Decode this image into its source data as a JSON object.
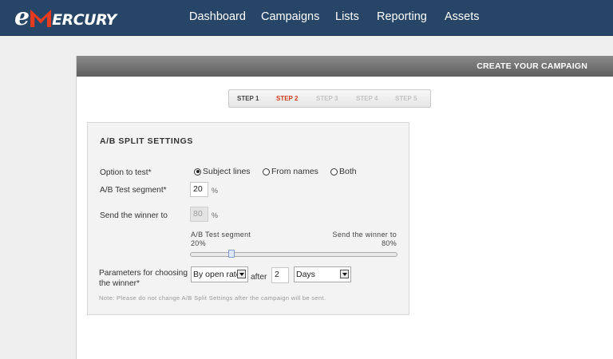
{
  "brand": {
    "logo_e": "e",
    "logo_rest": "ERCURY"
  },
  "nav": [
    {
      "label": "Dashboard"
    },
    {
      "label": "Campaigns"
    },
    {
      "label": "Lists"
    },
    {
      "label": "Reporting"
    },
    {
      "label": "Assets"
    }
  ],
  "panel": {
    "title": "CREATE YOUR CAMPAIGN"
  },
  "steps": [
    {
      "label": "STEP 1",
      "state": "done"
    },
    {
      "label": "STEP 2",
      "state": "active"
    },
    {
      "label": "STEP 3",
      "state": "upcoming"
    },
    {
      "label": "STEP 4",
      "state": "upcoming"
    },
    {
      "label": "STEP 5",
      "state": "upcoming"
    }
  ],
  "ab": {
    "title": "A/B SPLIT SETTINGS",
    "option_label": "Option to test*",
    "options": [
      {
        "label": "Subject lines",
        "checked": true
      },
      {
        "label": "From names",
        "checked": false
      },
      {
        "label": "Both",
        "checked": false
      }
    ],
    "segment_label": "A/B Test segment*",
    "segment_value": "20",
    "segment_unit": "%",
    "winner_label": "Send the winner to",
    "winner_value": "80",
    "winner_unit": "%",
    "slider": {
      "left_caption": "A/B Test segment",
      "left_value": "20%",
      "right_caption": "Send the winner to",
      "right_value": "80%",
      "position_percent": 20
    },
    "params_label_line1": "Parameters for choosing",
    "params_label_line2": "the winner*",
    "criterion_selected": "By open rate",
    "after_label": "after",
    "after_value": "2",
    "period_selected": "Days",
    "note": "Note: Please do not change A/B Split Settings after the campaign will be sent."
  },
  "colors": {
    "nav_bg": "#274566",
    "accent_red": "#e83a1f",
    "active_step": "#d23b1c"
  }
}
